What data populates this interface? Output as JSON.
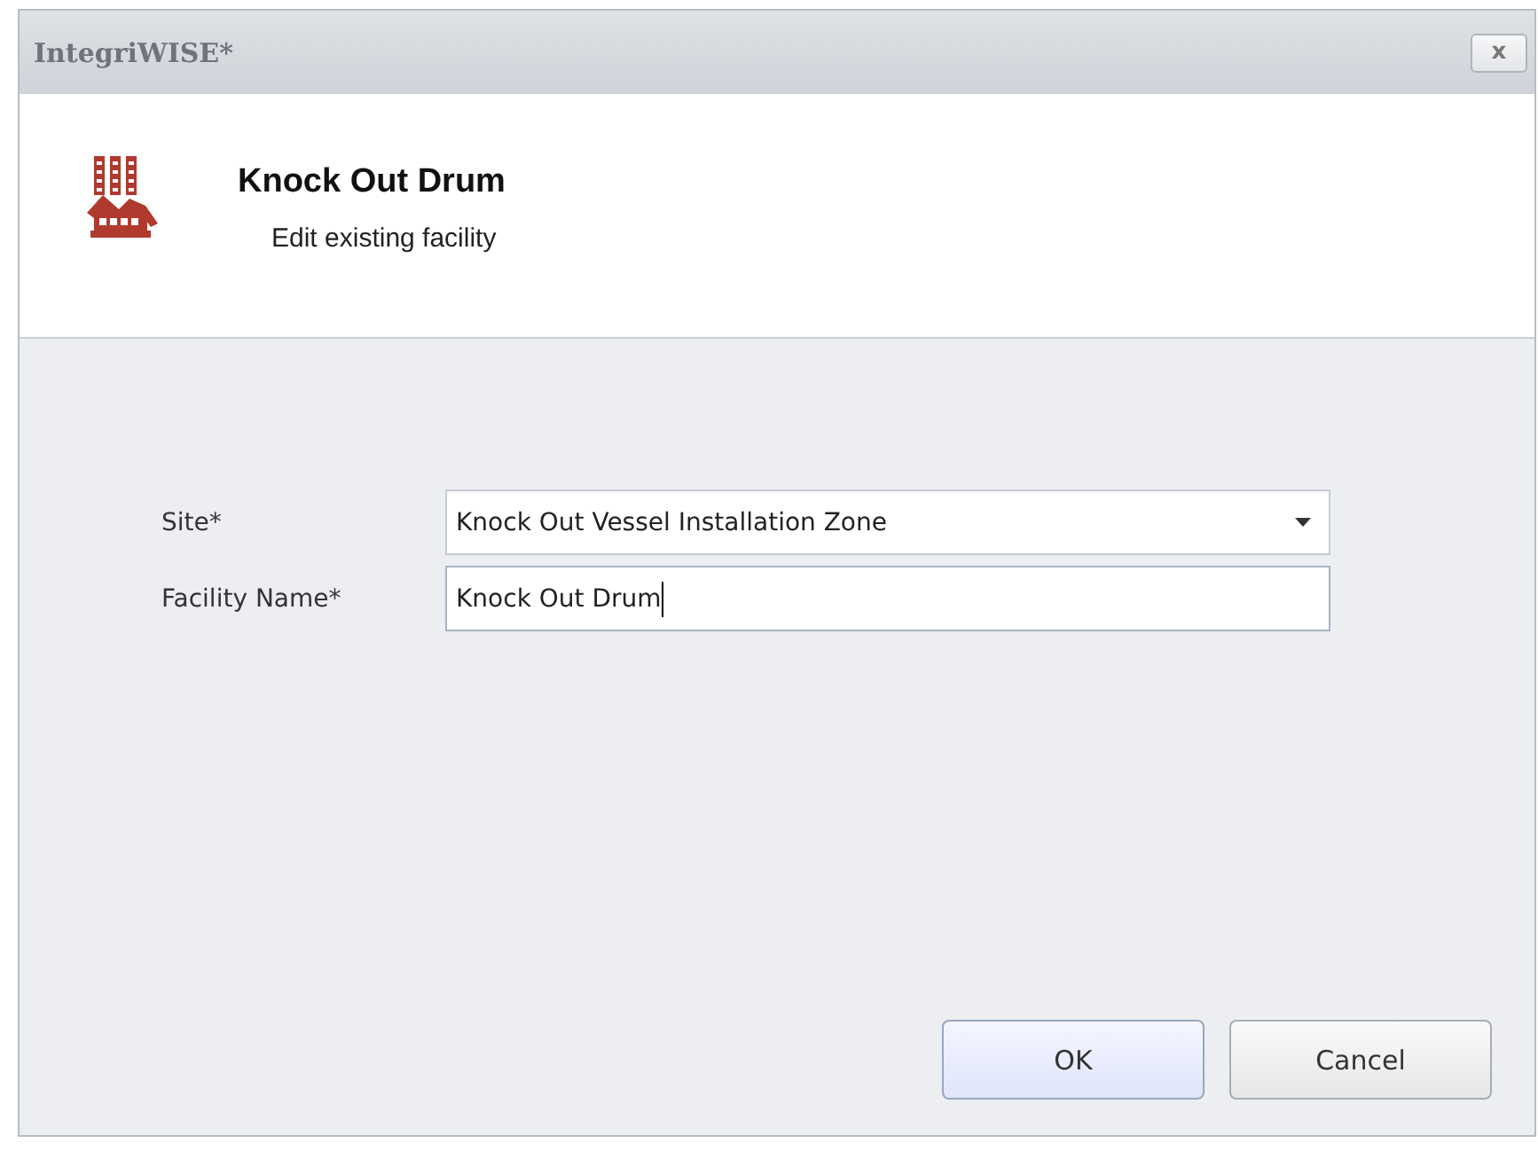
{
  "window": {
    "title": "IntegriWISE*",
    "close": "x"
  },
  "header": {
    "title": "Knock Out Drum",
    "subtitle": "Edit existing facility"
  },
  "fields": [
    {
      "kind": "dropdown",
      "label": "Site*",
      "value": "Knock Out Vessel Installation Zone",
      "focused": false
    },
    {
      "kind": "text",
      "label": "Facility Name*",
      "value": "Knock Out Drum",
      "focused": true
    }
  ],
  "buttons": [
    {
      "label": "OK",
      "default": true
    },
    {
      "label": "Cancel",
      "default": false
    }
  ]
}
